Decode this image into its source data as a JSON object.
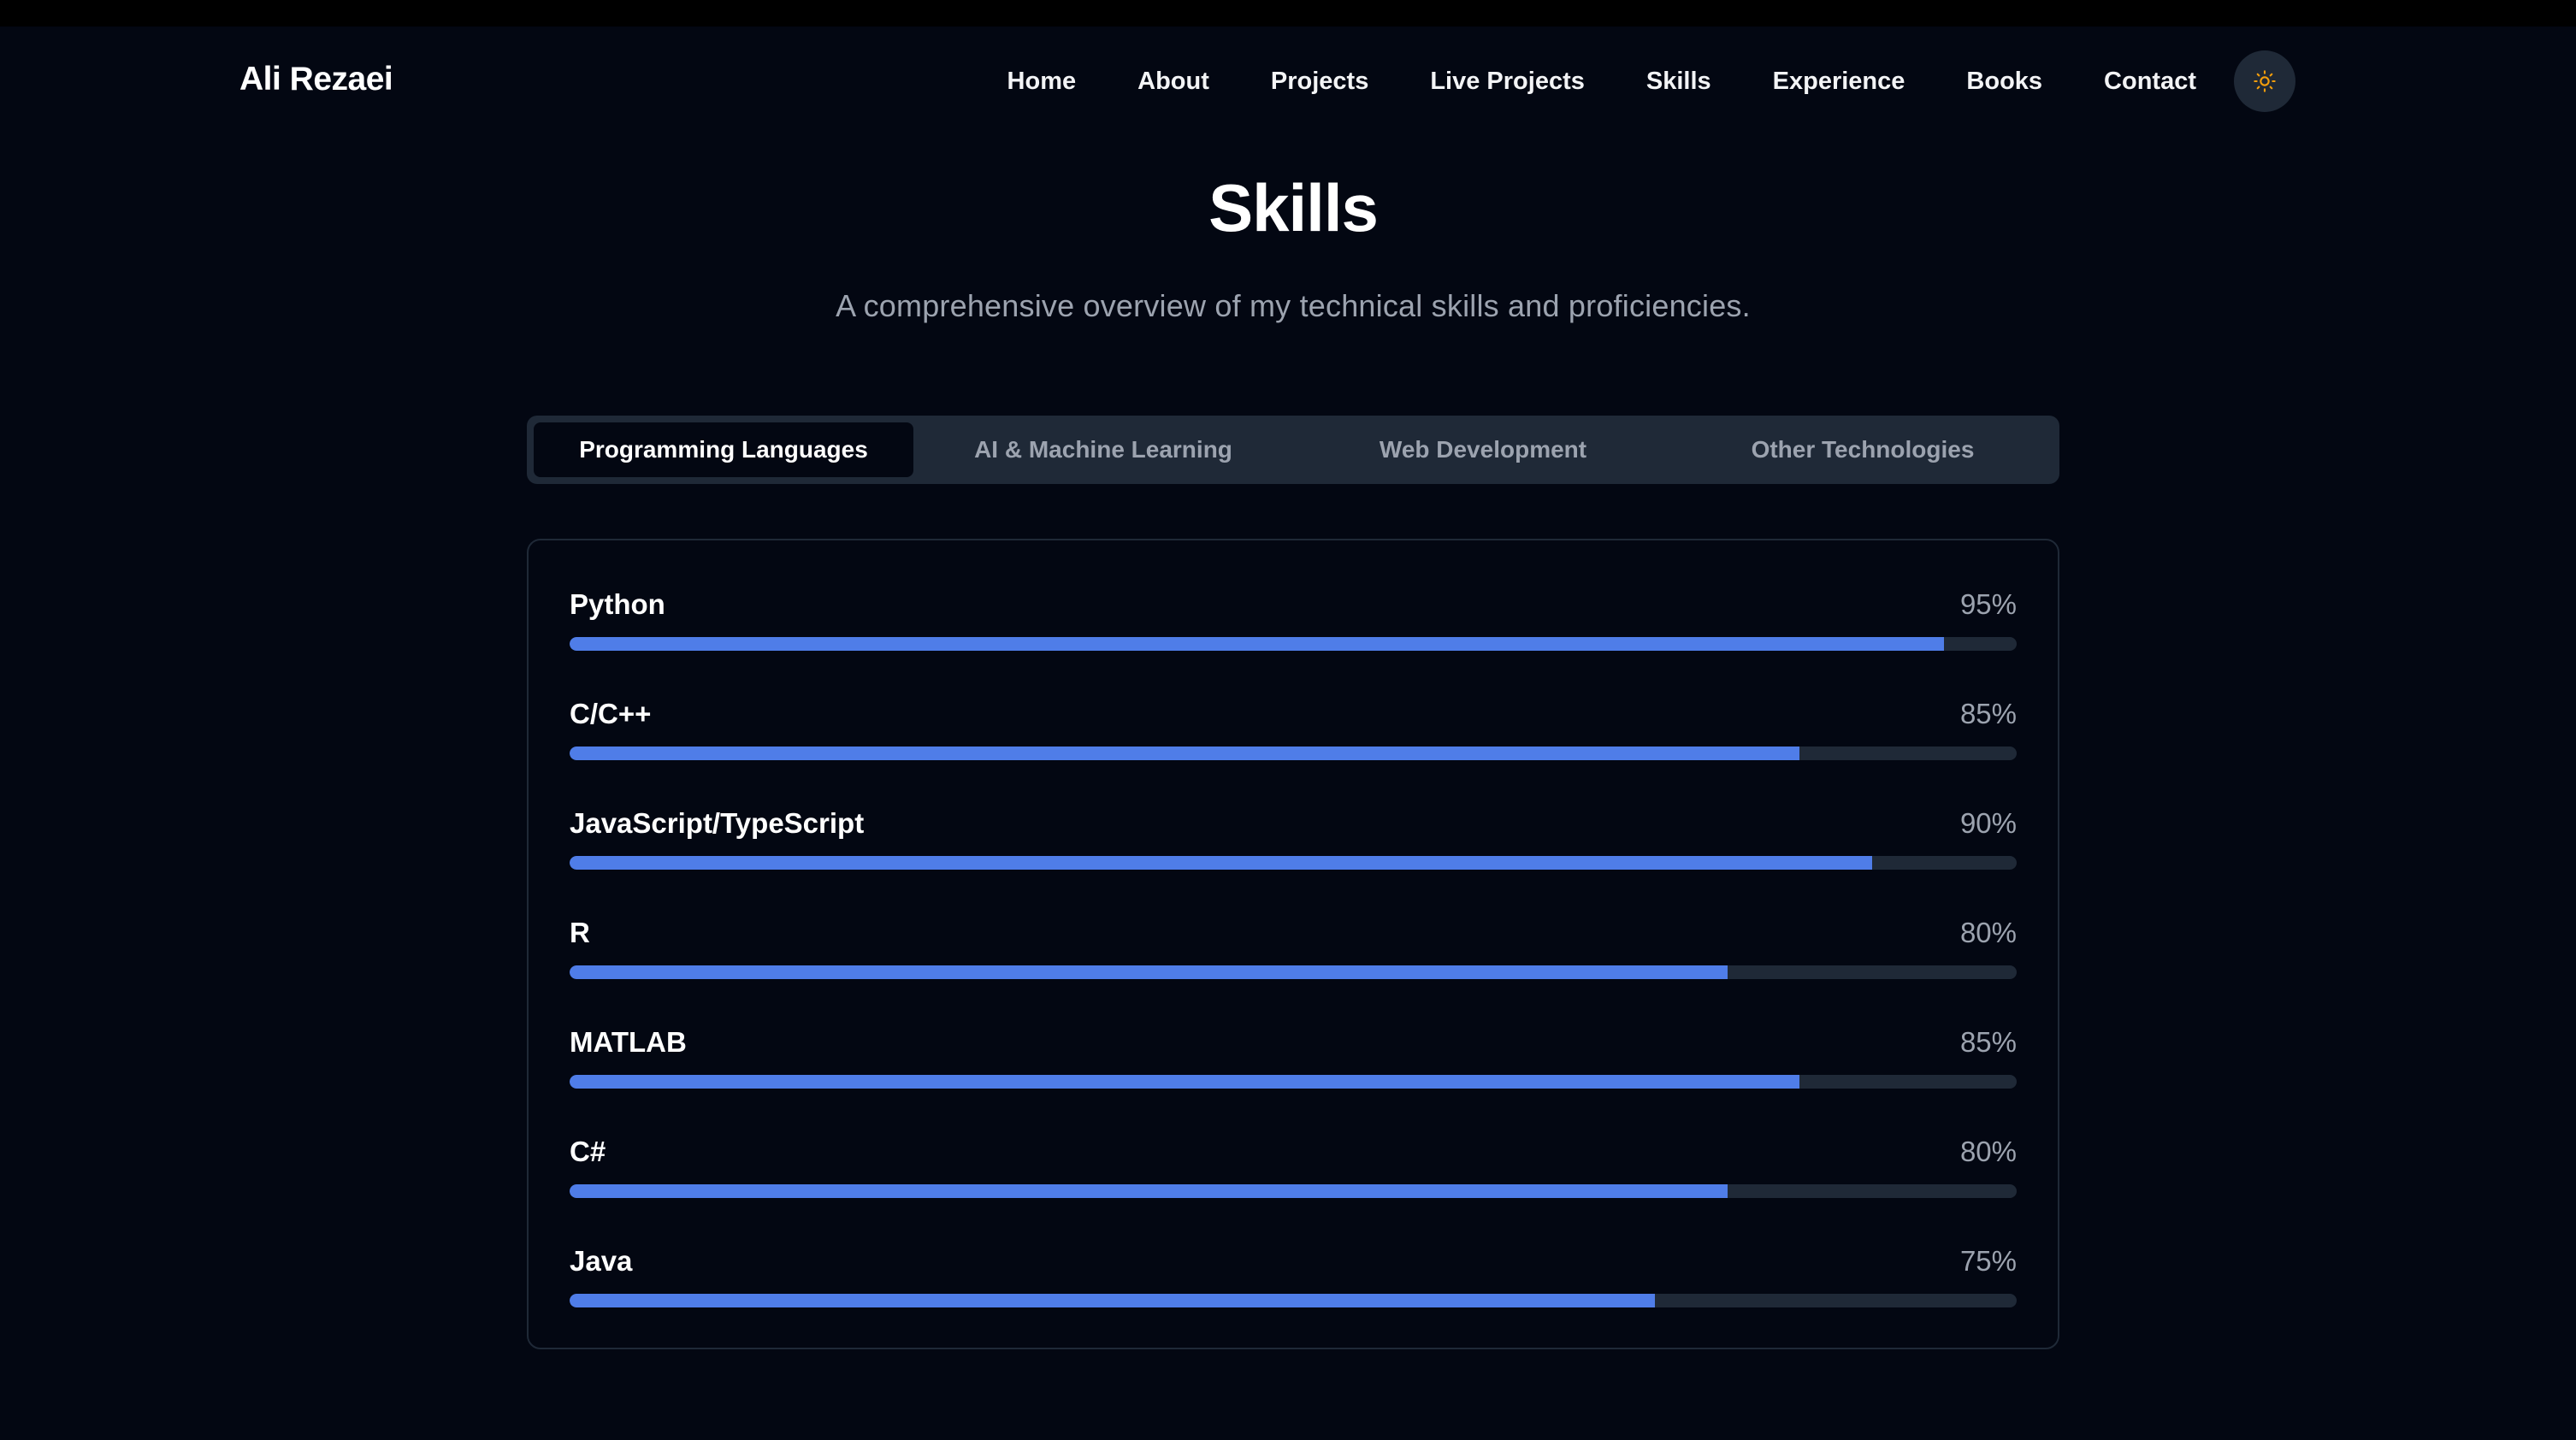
{
  "brand": "Ali Rezaei",
  "nav": {
    "links": [
      "Home",
      "About",
      "Projects",
      "Live Projects",
      "Skills",
      "Experience",
      "Books",
      "Contact"
    ],
    "theme_toggle_icon": "sun-icon"
  },
  "header": {
    "title": "Skills",
    "subtitle": "A comprehensive overview of my technical skills and proficiencies."
  },
  "tabs": {
    "items": [
      "Programming Languages",
      "AI & Machine Learning",
      "Web Development",
      "Other Technologies"
    ],
    "active": "Programming Languages"
  },
  "skills": [
    {
      "name": "Python",
      "percent_label": "95%",
      "level": 0.95
    },
    {
      "name": "C/C++",
      "percent_label": "85%",
      "level": 0.85
    },
    {
      "name": "JavaScript/TypeScript",
      "percent_label": "90%",
      "level": 0.9
    },
    {
      "name": "R",
      "percent_label": "80%",
      "level": 0.8
    },
    {
      "name": "MATLAB",
      "percent_label": "85%",
      "level": 0.85
    },
    {
      "name": "C#",
      "percent_label": "80%",
      "level": 0.8
    },
    {
      "name": "Java",
      "percent_label": "75%",
      "level": 0.75
    }
  ],
  "colors": {
    "background": "#030712",
    "accent": "#4f7de8",
    "track": "#1f2937",
    "muted_text": "#9ca3af",
    "sun_icon": "#f59e0b"
  }
}
